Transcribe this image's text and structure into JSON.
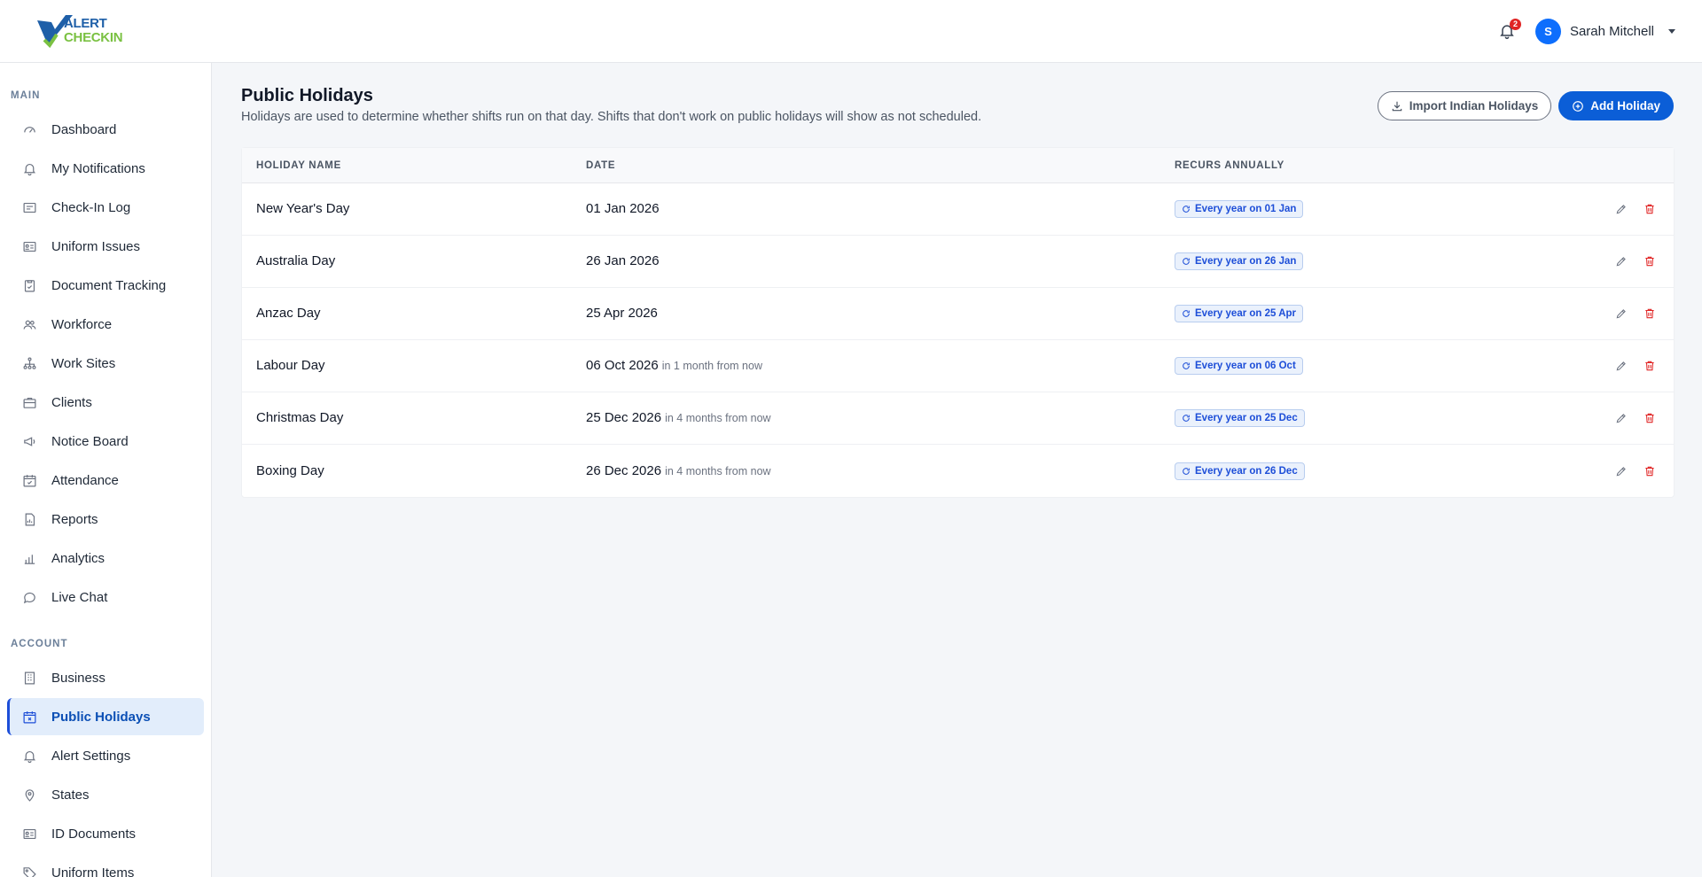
{
  "brand": {
    "line1": "ALERT",
    "line2": "CHECKIN",
    "primary": "#1e5fa8",
    "accent": "#7ac142"
  },
  "header": {
    "notifications_count": "2",
    "user": {
      "initial": "S",
      "name": "Sarah Mitchell"
    }
  },
  "sidebar": {
    "main_label": "MAIN",
    "main_items": [
      {
        "label": "Dashboard",
        "icon": "dashboard-icon"
      },
      {
        "label": "My Notifications",
        "icon": "bell-icon"
      },
      {
        "label": "Check-In Log",
        "icon": "log-icon"
      },
      {
        "label": "Uniform Issues",
        "icon": "id-card-icon"
      },
      {
        "label": "Document Tracking",
        "icon": "clipboard-icon"
      },
      {
        "label": "Workforce",
        "icon": "people-icon"
      },
      {
        "label": "Work Sites",
        "icon": "sitemap-icon"
      },
      {
        "label": "Clients",
        "icon": "briefcase-icon"
      },
      {
        "label": "Notice Board",
        "icon": "megaphone-icon"
      },
      {
        "label": "Attendance",
        "icon": "calendar-check-icon"
      },
      {
        "label": "Reports",
        "icon": "report-icon"
      },
      {
        "label": "Analytics",
        "icon": "bar-chart-icon"
      },
      {
        "label": "Live Chat",
        "icon": "chat-icon"
      }
    ],
    "account_label": "ACCOUNT",
    "account_items": [
      {
        "label": "Business",
        "icon": "building-icon"
      },
      {
        "label": "Public Holidays",
        "icon": "calendar-x-icon",
        "active": true
      },
      {
        "label": "Alert Settings",
        "icon": "bell-icon"
      },
      {
        "label": "States",
        "icon": "map-pin-icon"
      },
      {
        "label": "ID Documents",
        "icon": "id-card-icon"
      },
      {
        "label": "Uniform Items",
        "icon": "tag-icon"
      }
    ]
  },
  "page": {
    "title": "Public Holidays",
    "subtitle": "Holidays are used to determine whether shifts run on that day. Shifts that don't work on public holidays will show as not scheduled.",
    "import_button": "Import Indian Holidays",
    "add_button": "Add Holiday"
  },
  "table": {
    "headers": [
      "HOLIDAY NAME",
      "DATE",
      "RECURS ANNUALLY"
    ],
    "rows": [
      {
        "name": "New Year's Day",
        "date": "01 Jan 2026",
        "relative": "",
        "recurs": "Every year on 01 Jan"
      },
      {
        "name": "Australia Day",
        "date": "26 Jan 2026",
        "relative": "",
        "recurs": "Every year on 26 Jan"
      },
      {
        "name": "Anzac Day",
        "date": "25 Apr 2026",
        "relative": "",
        "recurs": "Every year on 25 Apr"
      },
      {
        "name": "Labour Day",
        "date": "06 Oct 2026",
        "relative": "in 1 month from now",
        "recurs": "Every year on 06 Oct"
      },
      {
        "name": "Christmas Day",
        "date": "25 Dec 2026",
        "relative": "in 4 months from now",
        "recurs": "Every year on 25 Dec"
      },
      {
        "name": "Boxing Day",
        "date": "26 Dec 2026",
        "relative": "in 4 months from now",
        "recurs": "Every year on 26 Dec"
      }
    ]
  },
  "colors": {
    "primary_button": "#0b5ed7",
    "delete": "#e02424",
    "active_nav_bg": "#e2edfb"
  }
}
